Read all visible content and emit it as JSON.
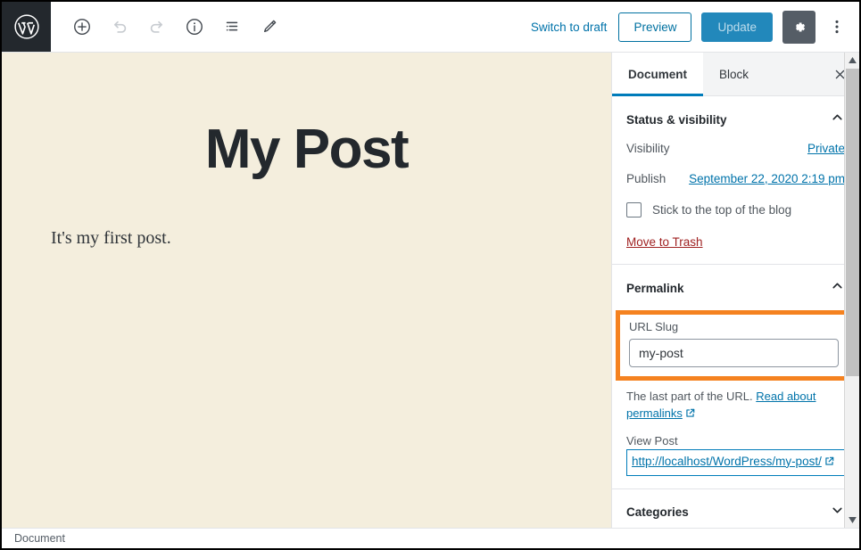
{
  "topbar": {
    "logo_icon": "wordpress-logo-icon",
    "tools": [
      {
        "name": "add-block-button",
        "icon": "plus-circle-icon",
        "state": "enabled"
      },
      {
        "name": "undo-button",
        "icon": "undo-arrow-icon",
        "state": "disabled"
      },
      {
        "name": "redo-button",
        "icon": "redo-arrow-icon",
        "state": "disabled"
      },
      {
        "name": "details-button",
        "icon": "info-circle-icon",
        "state": "enabled"
      },
      {
        "name": "list-view-button",
        "icon": "list-view-icon",
        "state": "enabled"
      },
      {
        "name": "edit-mode-button",
        "icon": "pencil-icon",
        "state": "enabled"
      }
    ],
    "switch_to_draft_label": "Switch to draft",
    "preview_label": "Preview",
    "update_label": "Update",
    "settings_icon": "gear-icon",
    "more_options_icon": "kebab-menu-icon",
    "accent_blue": "#0073aa",
    "update_bg": "#2288bb",
    "gear_bg": "#555d66"
  },
  "editor": {
    "background": "#f4eedd",
    "title": "My Post",
    "body_paragraph": "It's my first post."
  },
  "statusbar": {
    "label": "Document"
  },
  "sidebar": {
    "tabs": [
      {
        "label": "Document",
        "active": true
      },
      {
        "label": "Block",
        "active": false
      }
    ],
    "close_icon": "close-icon",
    "status_panel": {
      "title": "Status & visibility",
      "collapse_icon": "chevron-up-icon",
      "visibility_label": "Visibility",
      "visibility_value": "Private",
      "publish_label": "Publish",
      "publish_value": "September 22, 2020 2:19 pm",
      "sticky_label": "Stick to the top of the blog",
      "sticky_checked": false,
      "trash_label": "Move to Trash",
      "trash_color": "#a02222"
    },
    "permalink_panel": {
      "title": "Permalink",
      "collapse_icon": "chevron-up-icon",
      "highlight_color": "#f58220",
      "slug_label": "URL Slug",
      "slug_value": "my-post",
      "slug_placeholder": "my-post",
      "help_prefix": "The last part of the URL.",
      "help_link": "Read about permalinks",
      "external_link_icon": "external-link-icon",
      "view_post_label": "View Post",
      "view_post_url": "http://localhost/WordPress/my-post/"
    },
    "categories_panel": {
      "title": "Categories",
      "expand_icon": "chevron-down-icon"
    }
  },
  "scrollbar": {
    "up_icon": "scroll-up-arrow-icon",
    "down_icon": "scroll-down-arrow-icon",
    "thumb": "scrollbar-thumb"
  }
}
